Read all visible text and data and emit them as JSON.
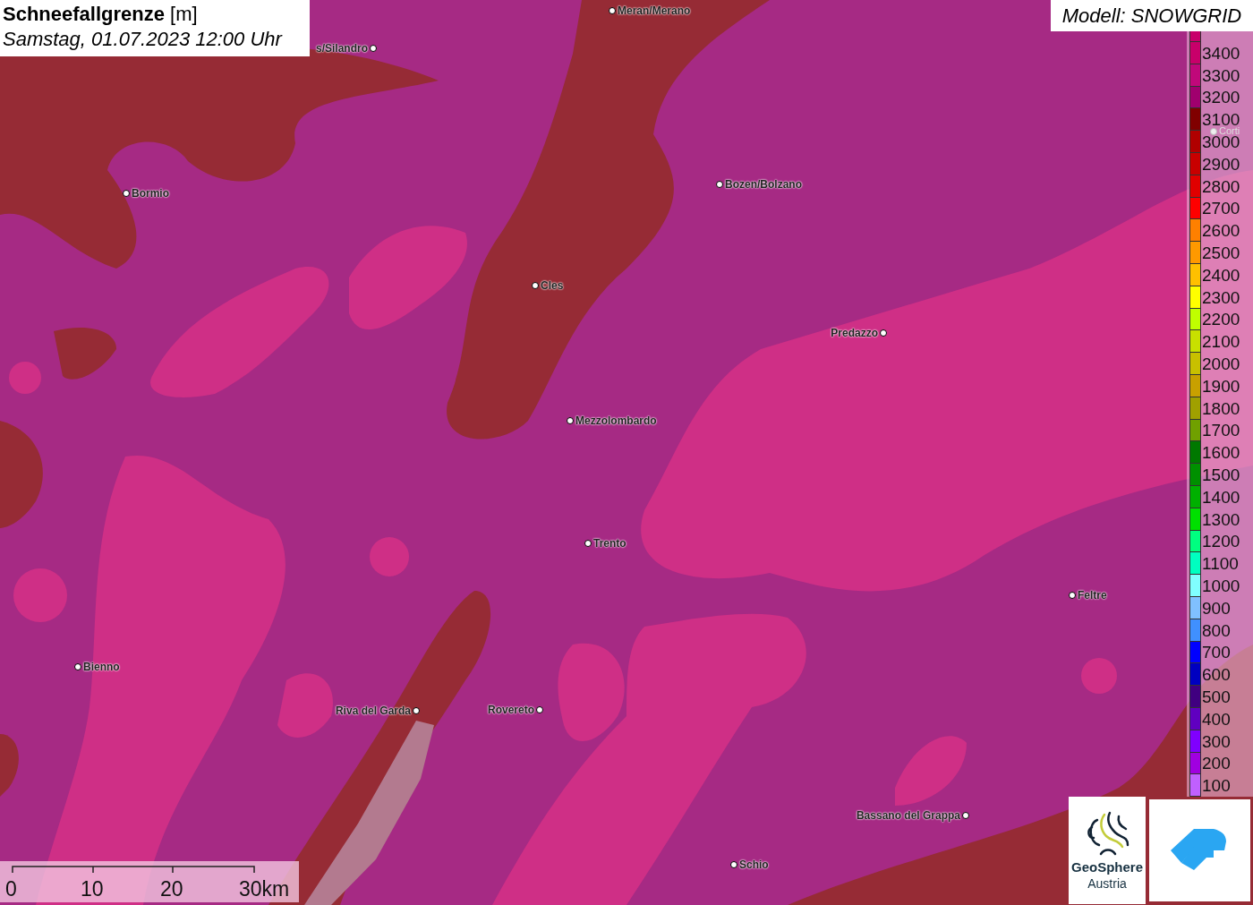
{
  "title": {
    "heading": "**Schneefallgrenze** [m]",
    "datetime": "Samstag, 01.07.2023 12:00 Uhr"
  },
  "model": "Modell: SNOWGRID",
  "cities": [
    {
      "name": "Meran/Merano",
      "dimmed": false
    },
    {
      "name": "s/Silandro",
      "dimmed": false
    },
    {
      "name": "Bormio",
      "dimmed": false
    },
    {
      "name": "Bozen/Bolzano",
      "dimmed": false
    },
    {
      "name": "Cles",
      "dimmed": false
    },
    {
      "name": "Predazzo",
      "dimmed": false
    },
    {
      "name": "Mezzolombardo",
      "dimmed": false
    },
    {
      "name": "Trento",
      "dimmed": false
    },
    {
      "name": "Feltre",
      "dimmed": false
    },
    {
      "name": "Bienno",
      "dimmed": false
    },
    {
      "name": "Riva del Garda",
      "dimmed": false
    },
    {
      "name": "Rovereto",
      "dimmed": false
    },
    {
      "name": "Bassano del Grappa",
      "dimmed": false
    },
    {
      "name": "Schio",
      "dimmed": false
    },
    {
      "name": "Corti",
      "dimmed": true
    }
  ],
  "legend": [
    {
      "label": "3400",
      "color": "#c8006a"
    },
    {
      "label": "3300",
      "color": "#c0087a"
    },
    {
      "label": "3200",
      "color": "#a0006e"
    },
    {
      "label": "3100",
      "color": "#800000"
    },
    {
      "label": "3000",
      "color": "#b00000"
    },
    {
      "label": "2900",
      "color": "#c80000"
    },
    {
      "label": "2800",
      "color": "#e00000"
    },
    {
      "label": "2700",
      "color": "#ff0000"
    },
    {
      "label": "2600",
      "color": "#ff8000"
    },
    {
      "label": "2500",
      "color": "#ff9900"
    },
    {
      "label": "2400",
      "color": "#ffc000"
    },
    {
      "label": "2300",
      "color": "#ffff00"
    },
    {
      "label": "2200",
      "color": "#c0ff00"
    },
    {
      "label": "2100",
      "color": "#c8e000"
    },
    {
      "label": "2000",
      "color": "#c8c000"
    },
    {
      "label": "1900",
      "color": "#c8a000"
    },
    {
      "label": "1800",
      "color": "#a0a000"
    },
    {
      "label": "1700",
      "color": "#70a000"
    },
    {
      "label": "1600",
      "color": "#007800"
    },
    {
      "label": "1500",
      "color": "#009000"
    },
    {
      "label": "1400",
      "color": "#00b000"
    },
    {
      "label": "1300",
      "color": "#00e000"
    },
    {
      "label": "1200",
      "color": "#00ff80"
    },
    {
      "label": "1100",
      "color": "#00ffc0"
    },
    {
      "label": "1000",
      "color": "#80ffff"
    },
    {
      "label": "900",
      "color": "#80c0ff"
    },
    {
      "label": "800",
      "color": "#4090ff"
    },
    {
      "label": "700",
      "color": "#0000ff"
    },
    {
      "label": "600",
      "color": "#0000c0"
    },
    {
      "label": "500",
      "color": "#400080"
    },
    {
      "label": "400",
      "color": "#6000c0"
    },
    {
      "label": "300",
      "color": "#8000ff"
    },
    {
      "label": "200",
      "color": "#a000e0"
    },
    {
      "label": "100",
      "color": "#c060ff"
    }
  ],
  "scale": [
    "0",
    "10",
    "20",
    "30km"
  ],
  "logos": {
    "name": "GeoSphere",
    "subtitle": "Austria"
  }
}
